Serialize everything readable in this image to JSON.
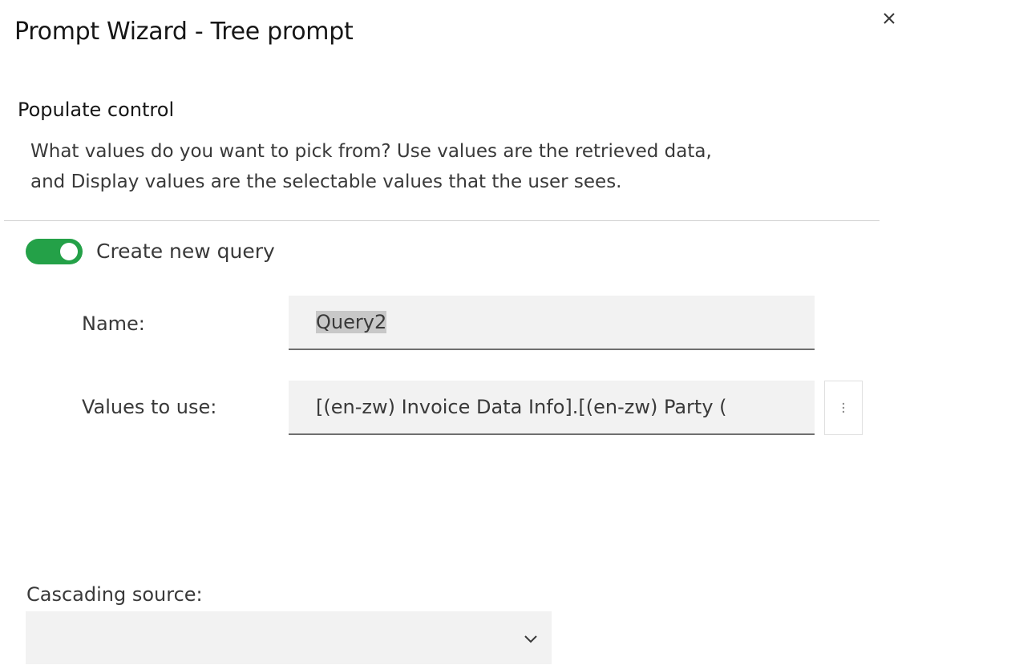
{
  "dialog": {
    "title": "Prompt Wizard - Tree prompt",
    "close_icon": "close-icon"
  },
  "populate_control": {
    "heading": "Populate control",
    "description_line1": "What values do you want to pick from? Use values are the retrieved data,",
    "description_line2": "and Display values are the selectable values that the user sees."
  },
  "create_new_query": {
    "label": "Create new query",
    "enabled": true,
    "toggle_color": "#24a148"
  },
  "form": {
    "name_label": "Name:",
    "name_value": "Query2",
    "values_label": "Values to use:",
    "values_value": "[(en-zw) Invoice Data Info].[(en-zw) Party (",
    "more_icon": "overflow-menu-vertical-icon"
  },
  "cascading": {
    "label": "Cascading source:",
    "selected": "",
    "chevron_icon": "chevron-down-icon"
  }
}
